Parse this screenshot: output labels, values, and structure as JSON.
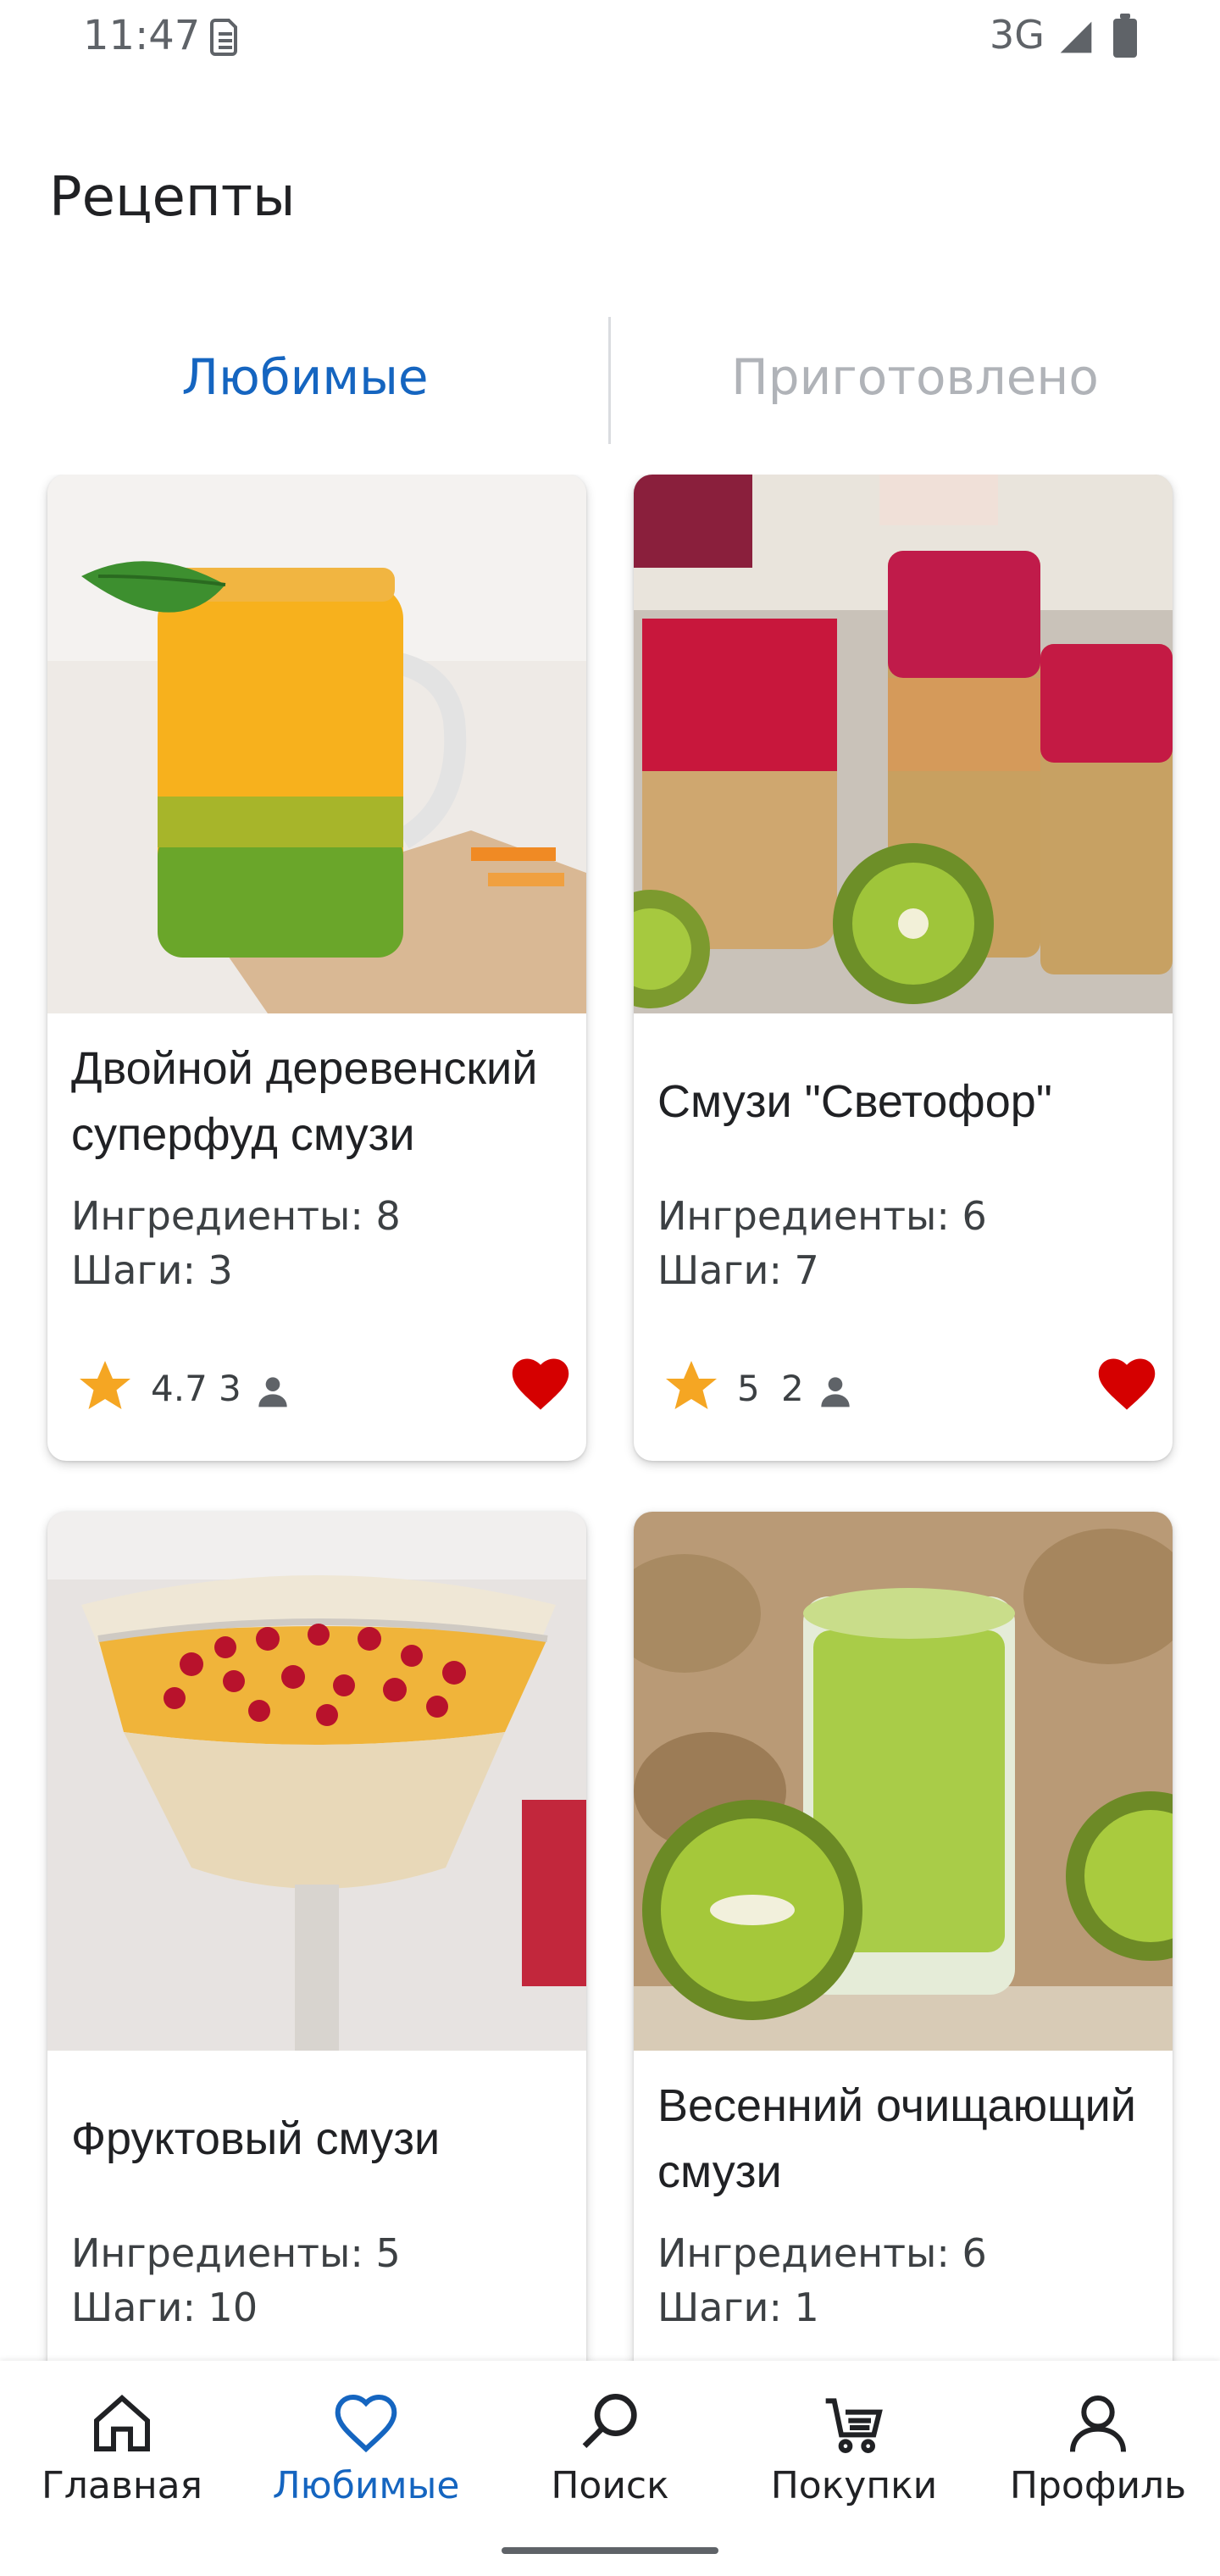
{
  "status_bar": {
    "time": "11:47",
    "network": "3G",
    "icons": [
      "sim-icon",
      "signal-icon",
      "battery-icon"
    ]
  },
  "page": {
    "title": "Рецепты"
  },
  "tabs": [
    {
      "label": "Любимые",
      "active": true
    },
    {
      "label": "Приготовлено",
      "active": false
    }
  ],
  "recipes": [
    {
      "title": "Двойной деревенский суперфуд смузи",
      "ingredients": "Ингредиенты: 8",
      "steps": "Шаги: 3",
      "rating": "4.7",
      "reviews": "3",
      "favorite": true,
      "image": "orange-green layered smoothie in mason jar with mint"
    },
    {
      "title": "Смузи \"Светофор\"",
      "ingredients": "Ингредиенты: 6",
      "steps": "Шаги: 7",
      "rating": "5",
      "reviews": "2",
      "favorite": true,
      "image": "red-orange-green layered smoothies in glasses with kiwi"
    },
    {
      "title": "Фруктовый смузи",
      "ingredients": "Ингредиенты: 5",
      "steps": "Шаги: 10",
      "rating": "",
      "reviews": "",
      "favorite": true,
      "image": "layered smoothie in cocktail glass with pomegranate seeds"
    },
    {
      "title": "Весенний очищающий смузи",
      "ingredients": "Ингредиенты: 6",
      "steps": "Шаги: 1",
      "rating": "",
      "reviews": "",
      "favorite": true,
      "image": "green kiwi smoothie in glass with kiwi halves"
    }
  ],
  "bottom_nav": [
    {
      "label": "Главная",
      "icon": "home-icon",
      "active": false
    },
    {
      "label": "Любимые",
      "icon": "heart-outline-icon",
      "active": true
    },
    {
      "label": "Поиск",
      "icon": "search-icon",
      "active": false
    },
    {
      "label": "Покупки",
      "icon": "cart-icon",
      "active": false
    },
    {
      "label": "Профиль",
      "icon": "person-icon",
      "active": false
    }
  ],
  "colors": {
    "accent": "#1565c0",
    "star": "#f5a623",
    "heart": "#d50000",
    "inactive_tab": "#b0b3b8"
  }
}
